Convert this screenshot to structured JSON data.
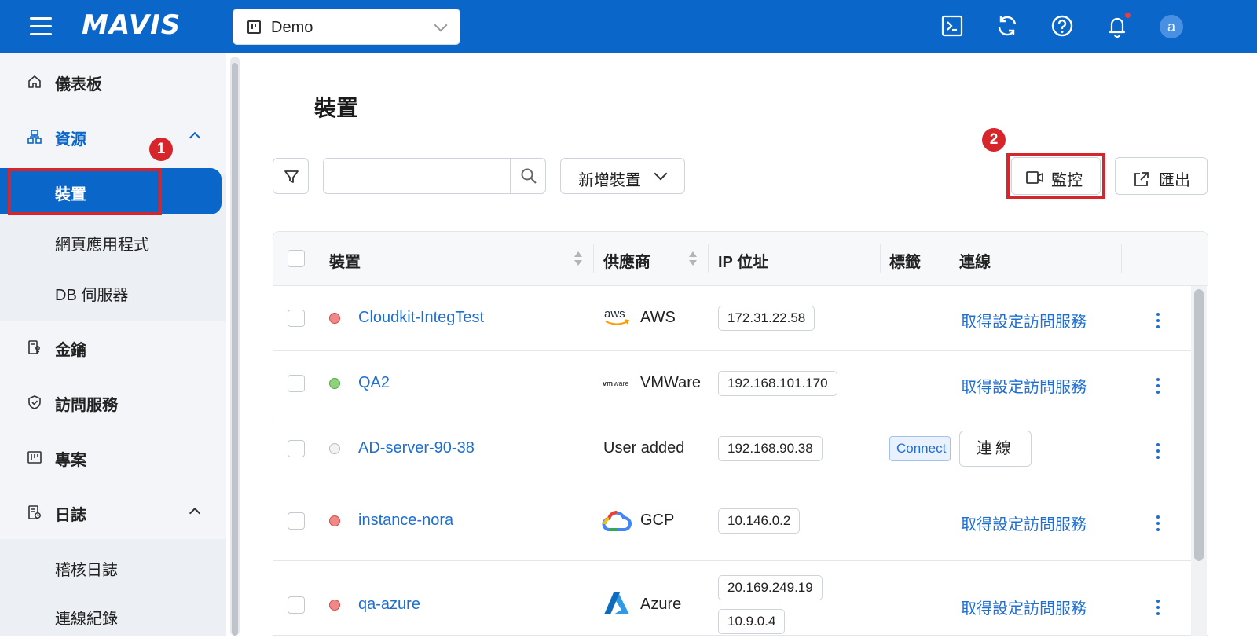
{
  "app": {
    "logo": "MAVIS"
  },
  "header": {
    "project_select": {
      "value": "Demo"
    },
    "icons": [
      "terminal-icon",
      "refresh-icon",
      "help-icon",
      "bell-icon"
    ],
    "avatar_letter": "a"
  },
  "sidebar": {
    "items": [
      {
        "label": "儀表板",
        "icon": "home-icon"
      },
      {
        "label": "資源",
        "icon": "resource-icon",
        "expanded": true,
        "children": [
          {
            "label": "裝置",
            "active": true
          },
          {
            "label": "網頁應用程式"
          },
          {
            "label": "DB 伺服器"
          }
        ]
      },
      {
        "label": "金鑰",
        "icon": "key-icon"
      },
      {
        "label": "訪問服務",
        "icon": "shield-icon"
      },
      {
        "label": "專案",
        "icon": "project-icon"
      },
      {
        "label": "日誌",
        "icon": "log-icon",
        "expanded": true,
        "children": [
          {
            "label": "稽核日誌"
          },
          {
            "label": "連線紀錄"
          }
        ]
      }
    ]
  },
  "annotations": {
    "badge1": "1",
    "badge2": "2"
  },
  "main": {
    "title": "裝置",
    "toolbar": {
      "search_placeholder": "",
      "add_device_label": "新增裝置",
      "monitor_label": "監控",
      "export_label": "匯出"
    },
    "table": {
      "columns": [
        "裝置",
        "供應商",
        "IP 位址",
        "標籤",
        "連線"
      ],
      "rows": [
        {
          "status": "red",
          "name": "Cloudkit-IntegTest",
          "vendor": "AWS",
          "vendor_logo": "aws-logo",
          "ips": [
            "172.31.22.58"
          ],
          "tag": "",
          "connection": "取得設定訪問服務"
        },
        {
          "status": "green",
          "name": "QA2",
          "vendor": "VMWare",
          "vendor_logo": "vmware-logo",
          "ips": [
            "192.168.101.170"
          ],
          "tag": "",
          "connection": "取得設定訪問服務"
        },
        {
          "status": "grey",
          "name": "AD-server-90-38",
          "vendor": "User added",
          "vendor_logo": "",
          "ips": [
            "192.168.90.38"
          ],
          "tag": "Connect",
          "connection_button": "連線"
        },
        {
          "status": "red",
          "name": "instance-nora",
          "vendor": "GCP",
          "vendor_logo": "gcp-logo",
          "ips": [
            "10.146.0.2"
          ],
          "tag": "",
          "connection": "取得設定訪問服務"
        },
        {
          "status": "red",
          "name": "qa-azure",
          "vendor": "Azure",
          "vendor_logo": "azure-logo",
          "ips": [
            "20.169.249.19",
            "10.9.0.4"
          ],
          "tag": "",
          "connection": "取得設定訪問服務"
        }
      ]
    }
  },
  "colors": {
    "primary": "#0a66c9",
    "link": "#1f6fd1",
    "annotation_red": "#d7262b"
  }
}
